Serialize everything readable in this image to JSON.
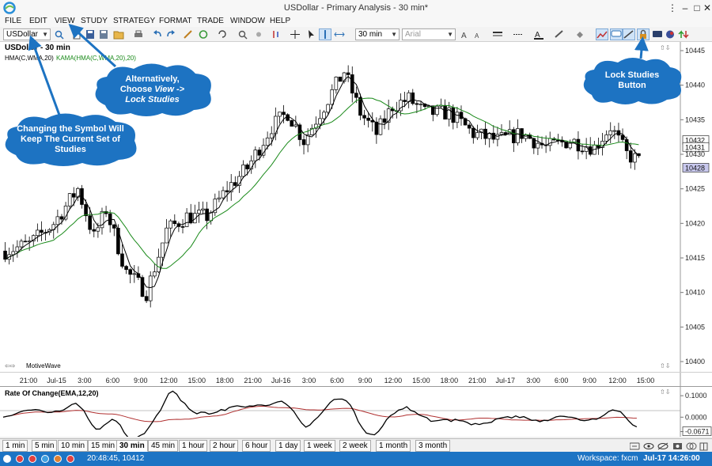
{
  "window": {
    "title": "USDollar - Primary Analysis - 30 min*",
    "minimize_glyph": "–",
    "maximize_glyph": "□",
    "close_glyph": "✕",
    "menu_glyph": "⋮"
  },
  "menu": [
    "FILE",
    "EDIT",
    "VIEW",
    "STUDY",
    "STRATEGY",
    "FORMAT",
    "TRADE",
    "WINDOW",
    "HELP"
  ],
  "toolbar": {
    "symbol": "USDollar",
    "bar_size": "30 min",
    "font_name": "Arial"
  },
  "chart": {
    "header": "USDollar - 30 min",
    "study_hma": "HMA(C,WMA,20)",
    "study_kama": "KAMA(HMA(C,WMA,20),20)",
    "watermark": "MotiveWave",
    "price_ticks": [
      "10445",
      "10440",
      "10435",
      "10430",
      "10425",
      "10420",
      "10415",
      "10410",
      "10405",
      "10400"
    ],
    "price_labels": [
      "10432",
      "10431",
      "10428"
    ],
    "time_ticks": [
      "21:00",
      "Jul-15",
      "3:00",
      "6:00",
      "9:00",
      "12:00",
      "15:00",
      "18:00",
      "21:00",
      "Jul-16",
      "3:00",
      "6:00",
      "9:00",
      "12:00",
      "15:00",
      "18:00",
      "21:00",
      "Jul-17",
      "3:00",
      "6:00",
      "9:00",
      "12:00",
      "15:00"
    ],
    "colors": {
      "hma": "#000000",
      "kama": "#1a8a1a",
      "roc": "#000000",
      "roc_signal": "#b03030"
    }
  },
  "roc": {
    "title": "Rate Of Change(EMA,12,20)",
    "ticks": [
      "0.1000",
      "0.0000",
      "-0.0671"
    ]
  },
  "bar_tabs": [
    "1 min",
    "5 min",
    "10 min",
    "15 min",
    "30 min",
    "45 min",
    "1 hour",
    "2 hour",
    "6 hour",
    "1 day",
    "1 week",
    "2 week",
    "1 month",
    "3 month"
  ],
  "selected_tab": "30 min",
  "status": {
    "clock": "20:48:45, 10412",
    "workspace": "Workspace: fxcm",
    "datetime": "Jul-17 14:26:00"
  },
  "callouts": {
    "symbol": "Changing the Symbol Will Keep The Current Set of Studies",
    "view_line1": "Alternatively,",
    "view_line2": "Choose",
    "view_line2_italic": "View ->",
    "view_line3": "Lock Studies",
    "lock": "Lock Studies Button"
  }
}
